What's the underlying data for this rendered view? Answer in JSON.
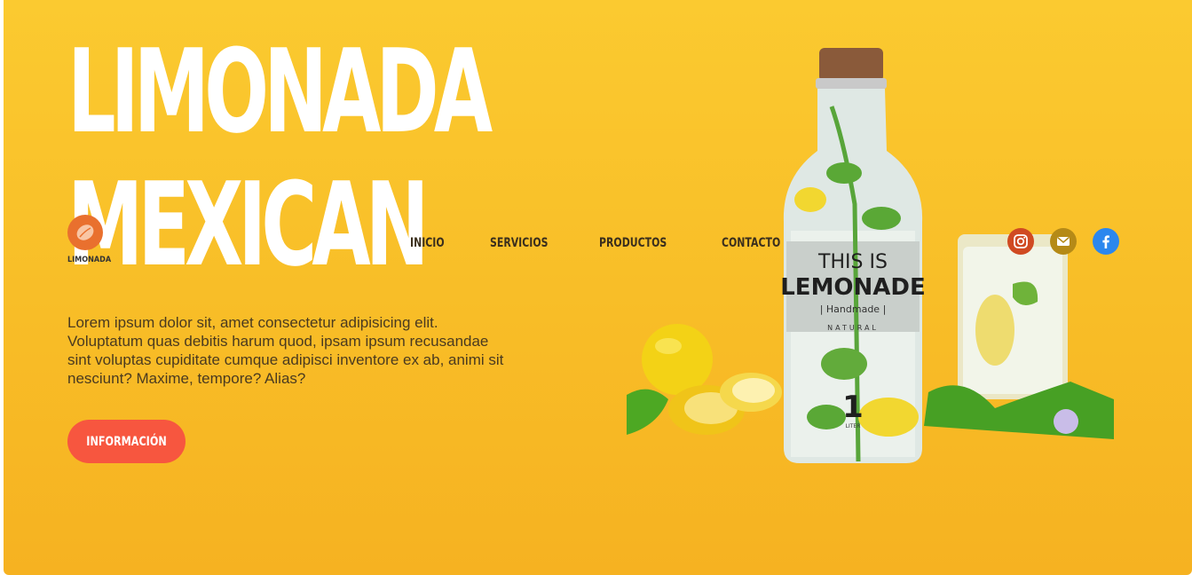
{
  "hero": {
    "title_line1": "LIMONADA",
    "title_line2": "MEXICAN",
    "description": "Lorem ipsum dolor sit, amet consectetur adipisicing elit. Voluptatum quas debitis harum quod, ipsam ipsum recusandae sint voluptas cupiditate cumque adipisci inventore ex ab, animi sit nesciunt? Maxime, tempore? Alias?",
    "button_label": "INFORMACIÓN"
  },
  "logo": {
    "label": "LIMONADA",
    "icon": "lemon-icon"
  },
  "nav": {
    "items": [
      {
        "label": "INICIO"
      },
      {
        "label": "SERVICIOS"
      },
      {
        "label": "PRODUCTOS"
      },
      {
        "label": "CONTACTO"
      }
    ]
  },
  "social": [
    {
      "icon": "instagram-icon",
      "color": "#d04a22"
    },
    {
      "icon": "mail-icon",
      "color": "#b58a17"
    },
    {
      "icon": "facebook-icon",
      "color": "#2b87ee"
    }
  ],
  "product_image": {
    "label_line1": "THIS IS",
    "label_line2": "LEMONADE",
    "label_line3": "| Handmade |",
    "label_line4": "NATURAL",
    "volume_number": "1",
    "volume_unit": "LITER"
  },
  "colors": {
    "background_top": "#fbca30",
    "background_bottom": "#f6b221",
    "title": "#ffffff",
    "button": "#f7563f",
    "logo": "#e9702e"
  }
}
